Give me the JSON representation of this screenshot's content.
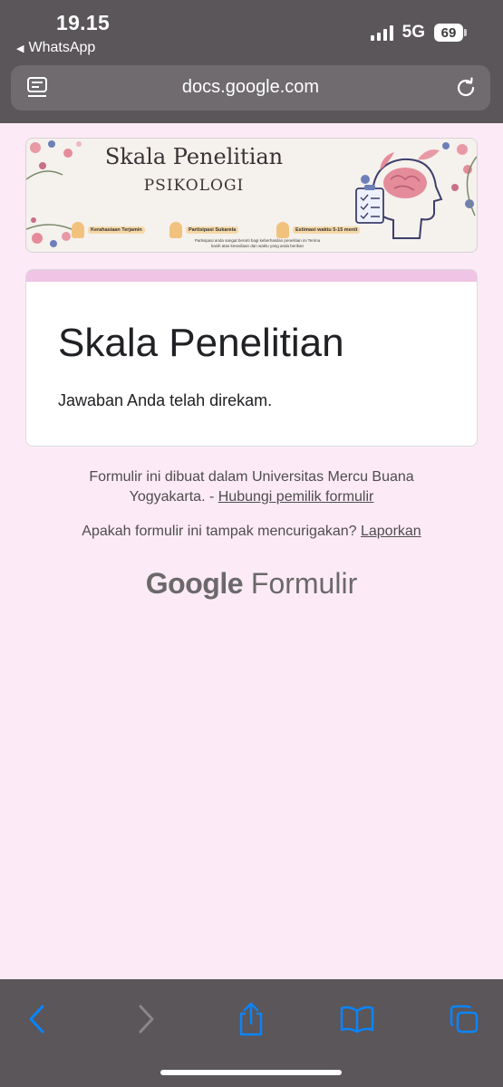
{
  "status_bar": {
    "time": "19.15",
    "back_app": "WhatsApp",
    "network": "5G",
    "battery": "69"
  },
  "browser": {
    "url": "docs.google.com"
  },
  "banner": {
    "title": "Skala Penelitian",
    "subtitle": "PSIKOLOGI",
    "chips": [
      "Kerahasiaan Terjamin",
      "Partisipasi Sukarela",
      "Estimasi waktu 5-15 menit"
    ],
    "note": "Partisipasi anda sangat berarti bagi keberhasilan penelitian ini Terima kasih atas kesediaan dan waktu yang anda berikan"
  },
  "card": {
    "title": "Skala Penelitian",
    "message": "Jawaban Anda telah direkam."
  },
  "footer": {
    "line1": "Formulir ini dibuat dalam Universitas Mercu Buana",
    "line2_prefix": "Yogyakarta. - ",
    "contact_link": "Hubungi pemilik formulir",
    "report_prefix": "Apakah formulir ini tampak mencurigakan? ",
    "report_link": "Laporkan",
    "logo_google": "Google",
    "logo_product": "Formulir"
  },
  "toolbar": {
    "icons": [
      "back-icon",
      "forward-icon",
      "share-icon",
      "bookmarks-icon",
      "tabs-icon"
    ]
  },
  "colors": {
    "chrome": "#5a5659",
    "page_bg": "#fcebf6",
    "accent": "#efc4e5",
    "ios_blue": "#0a84ff"
  }
}
